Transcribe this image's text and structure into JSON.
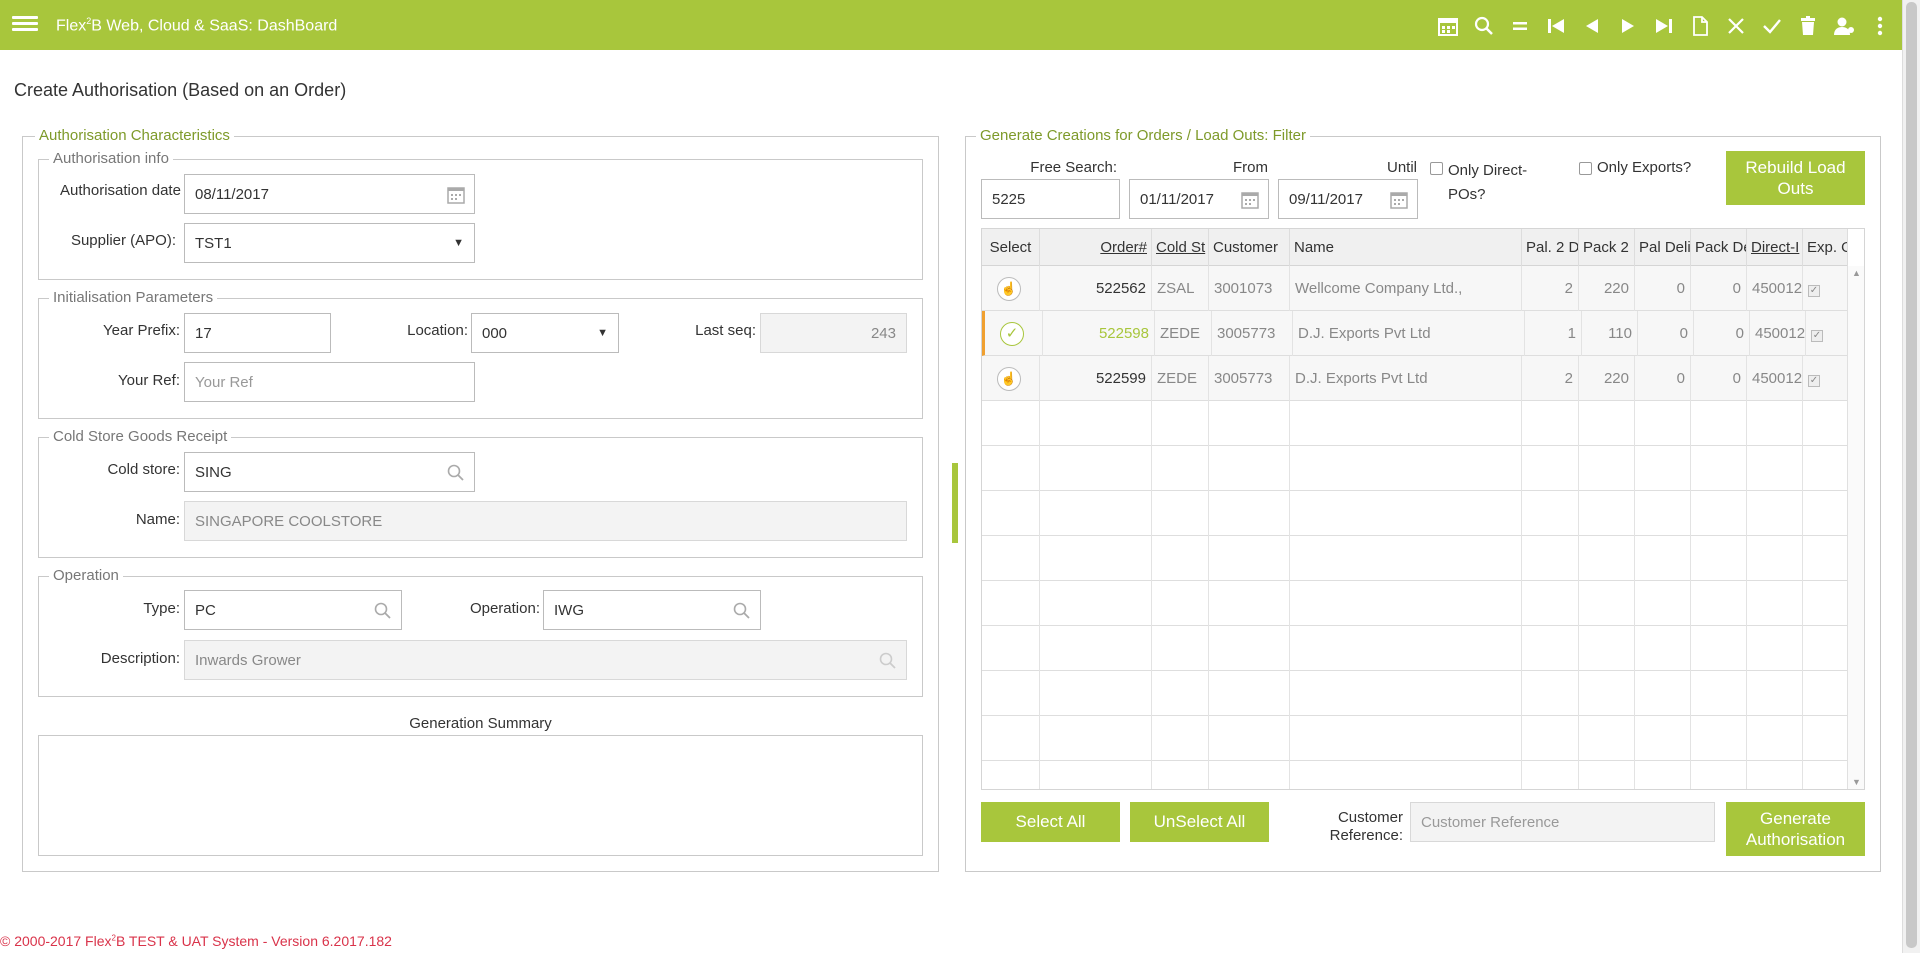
{
  "app": {
    "title_prefix": "Flex",
    "title_sup": "2",
    "title_suffix": "B Web, Cloud & SaaS: DashBoard",
    "accent": "#a8c63c"
  },
  "toolbar": {
    "icons": [
      "calendar-icon",
      "search-icon",
      "equals-icon",
      "first-icon",
      "previous-icon",
      "next-icon",
      "last-icon",
      "new-document-icon",
      "close-icon",
      "check-icon",
      "delete-icon",
      "user-icon",
      "more-icon"
    ]
  },
  "page": {
    "heading": "Create Authorisation (Based on an Order)"
  },
  "left": {
    "section_title": "Authorisation Characteristics",
    "auth_info": {
      "title": "Authorisation info",
      "date_label": "Authorisation date",
      "date_value": "08/11/2017",
      "supplier_label": "Supplier (APO):",
      "supplier_value": "TST1"
    },
    "init": {
      "title": "Initialisation Parameters",
      "year_label": "Year Prefix:",
      "year_value": "17",
      "location_label": "Location:",
      "location_value": "000",
      "lastseq_label": "Last seq:",
      "lastseq_value": "243",
      "yourref_label": "Your Ref:",
      "yourref_placeholder": "Your Ref"
    },
    "cold": {
      "title": "Cold Store Goods Receipt",
      "store_label": "Cold store:",
      "store_value": "SING",
      "name_label": "Name:",
      "name_value": "SINGAPORE COOLSTORE"
    },
    "operation": {
      "title": "Operation",
      "type_label": "Type:",
      "type_value": "PC",
      "op_label": "Operation:",
      "op_value": "IWG",
      "desc_label": "Description:",
      "desc_value": "Inwards Grower"
    },
    "summary_title": "Generation Summary"
  },
  "right": {
    "section_title": "Generate Creations for Orders / Load Outs: Filter",
    "free_search_label": "Free Search:",
    "free_search_value": "5225",
    "from_label": "From",
    "from_value": "01/11/2017",
    "until_label": "Until",
    "until_value": "09/11/2017",
    "only_direct_label": "Only Direct-POs?",
    "only_exports_label": "Only Exports?",
    "rebuild_label": "Rebuild Load Outs",
    "columns": [
      "Select",
      "Order#",
      "Cold St",
      "Customer",
      "Name",
      "Pal. 2 D",
      "Pack 2",
      "Pal Deli",
      "Pack De",
      "Direct-I",
      "Exp. O"
    ],
    "rows": [
      {
        "selected": false,
        "order": "522562",
        "cold": "ZSAL",
        "customer": "3001073",
        "name": "Wellcome Company Ltd.,",
        "pal2": "2",
        "pack2": "220",
        "paldel": "0",
        "packdel": "0",
        "direct": "450012",
        "exp": "✓"
      },
      {
        "selected": true,
        "order": "522598",
        "cold": "ZEDE",
        "customer": "3005773",
        "name": "D.J. Exports Pvt Ltd",
        "pal2": "1",
        "pack2": "110",
        "paldel": "0",
        "packdel": "0",
        "direct": "450012",
        "exp": "✓"
      },
      {
        "selected": false,
        "order": "522599",
        "cold": "ZEDE",
        "customer": "3005773",
        "name": "D.J. Exports Pvt Ltd",
        "pal2": "2",
        "pack2": "220",
        "paldel": "0",
        "packdel": "0",
        "direct": "450012",
        "exp": "✓"
      }
    ],
    "select_all_label": "Select All",
    "unselect_all_label": "UnSelect All",
    "cust_ref_label": "Customer Reference:",
    "cust_ref_placeholder": "Customer Reference",
    "generate_label": "Generate Authorisation"
  },
  "footer": {
    "prefix": "© 2000-2017 Flex",
    "sup": "2",
    "suffix": "B TEST & UAT System - Version 6.2017.182"
  }
}
